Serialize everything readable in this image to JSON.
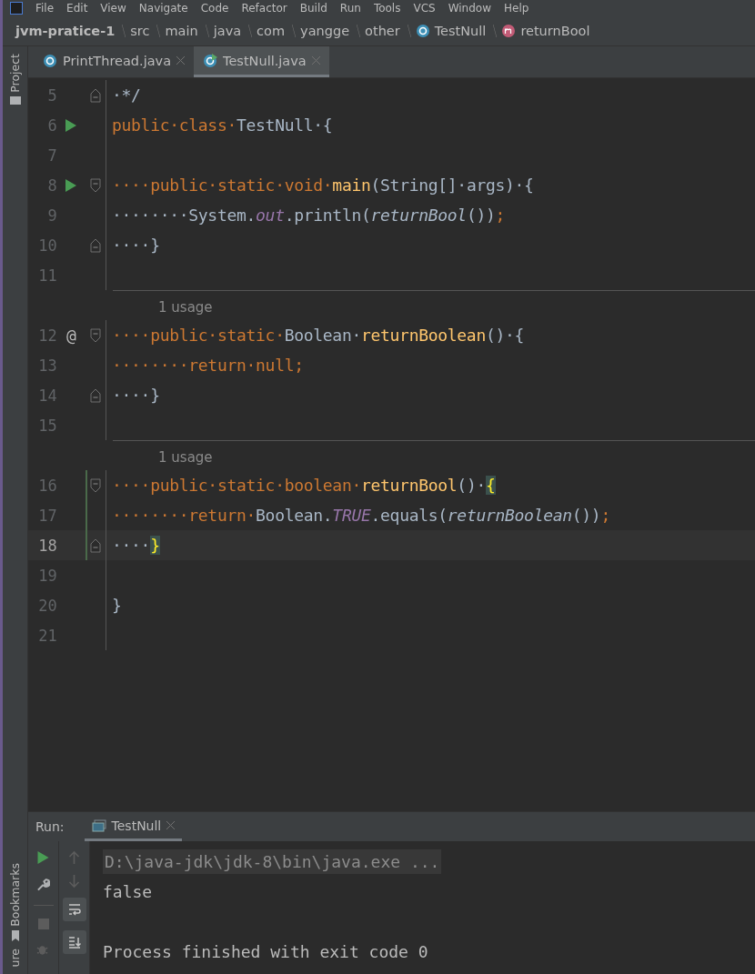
{
  "menu": [
    "File",
    "Edit",
    "View",
    "Navigate",
    "Code",
    "Refactor",
    "Build",
    "Run",
    "Tools",
    "VCS",
    "Window",
    "Help"
  ],
  "breadcrumbs": [
    {
      "label": "jvm-pratice-1",
      "kind": "project"
    },
    {
      "label": "src",
      "kind": "folder"
    },
    {
      "label": "main",
      "kind": "folder"
    },
    {
      "label": "java",
      "kind": "folder"
    },
    {
      "label": "com",
      "kind": "folder"
    },
    {
      "label": "yangge",
      "kind": "folder"
    },
    {
      "label": "other",
      "kind": "folder"
    },
    {
      "label": "TestNull",
      "kind": "class"
    },
    {
      "label": "returnBool",
      "kind": "method"
    }
  ],
  "left_tools": {
    "top": [
      "Project"
    ],
    "bottom": [
      "Bookmarks",
      "ure"
    ]
  },
  "tabs": [
    {
      "label": "PrintThread.java",
      "selected": false,
      "runnable": false
    },
    {
      "label": "TestNull.java",
      "selected": true,
      "runnable": true
    }
  ],
  "lines": [
    {
      "number": "5",
      "tokens": [
        {
          "text": "·*/",
          "kind": "plain"
        }
      ],
      "fold_end": true
    },
    {
      "number": "6",
      "tokens": [
        {
          "text": "public·class·",
          "kind": "kw"
        },
        {
          "text": "TestNull·{",
          "kind": "plain"
        }
      ],
      "runnable": true
    },
    {
      "number": "7"
    },
    {
      "number": "8",
      "tokens": [
        {
          "text": "····public·static·void·",
          "kind": "kw"
        },
        {
          "text": "main",
          "kind": "decl"
        },
        {
          "text": "(String[]·args)·{",
          "kind": "plain"
        }
      ],
      "runnable": true,
      "fold_start": true
    },
    {
      "number": "9",
      "tokens": [
        {
          "text": "········System.",
          "kind": "plain"
        },
        {
          "text": "out",
          "kind": "field"
        },
        {
          "text": ".println(",
          "kind": "plain"
        },
        {
          "text": "returnBool",
          "kind": "call"
        },
        {
          "text": "())",
          "kind": "plain"
        },
        {
          "text": ";",
          "kind": "kw"
        }
      ]
    },
    {
      "number": "10",
      "tokens": [
        {
          "text": "····}",
          "kind": "plain"
        }
      ],
      "fold_end": true
    },
    {
      "number": "11"
    },
    {
      "usage": "1 usage"
    },
    {
      "number": "12",
      "tokens": [
        {
          "text": "····public·static·",
          "kind": "kw"
        },
        {
          "text": "Boolean·",
          "kind": "plain"
        },
        {
          "text": "returnBoolean",
          "kind": "decl"
        },
        {
          "text": "()·{",
          "kind": "plain"
        }
      ],
      "gutter_text": "@",
      "fold_start": true
    },
    {
      "number": "13",
      "tokens": [
        {
          "text": "········return·null;",
          "kind": "kw"
        }
      ]
    },
    {
      "number": "14",
      "tokens": [
        {
          "text": "····}",
          "kind": "plain"
        }
      ],
      "fold_end": true
    },
    {
      "number": "15"
    },
    {
      "usage": "1 usage"
    },
    {
      "number": "16",
      "tokens": [
        {
          "text": "····public·static·boolean·",
          "kind": "kw"
        },
        {
          "text": "returnBool",
          "kind": "decl"
        },
        {
          "text": "()·",
          "kind": "plain"
        },
        {
          "text": "{",
          "kind": "brace"
        }
      ],
      "fold_start": true,
      "changed": true
    },
    {
      "number": "17",
      "tokens": [
        {
          "text": "········return·",
          "kind": "kw"
        },
        {
          "text": "Boolean.",
          "kind": "plain"
        },
        {
          "text": "TRUE",
          "kind": "field"
        },
        {
          "text": ".equals(",
          "kind": "plain"
        },
        {
          "text": "returnBoolean",
          "kind": "call"
        },
        {
          "text": "())",
          "kind": "plain"
        },
        {
          "text": ";",
          "kind": "kw"
        }
      ],
      "changed": true
    },
    {
      "number": "18",
      "tokens": [
        {
          "text": "····",
          "kind": "plain"
        },
        {
          "text": "}",
          "kind": "brace"
        }
      ],
      "fold_end": true,
      "changed": true,
      "current": true
    },
    {
      "number": "19"
    },
    {
      "number": "20",
      "tokens": [
        {
          "text": "}",
          "kind": "plain"
        }
      ]
    },
    {
      "number": "21"
    }
  ],
  "run_panel": {
    "label": "Run:",
    "tab": "TestNull",
    "console": [
      {
        "text": "D:\\java-jdk\\jdk-8\\bin\\java.exe ...",
        "kind": "command"
      },
      {
        "text": "false",
        "kind": "output"
      },
      {
        "kind": "blank"
      },
      {
        "text": "Process finished with exit code 0",
        "kind": "output"
      }
    ]
  }
}
